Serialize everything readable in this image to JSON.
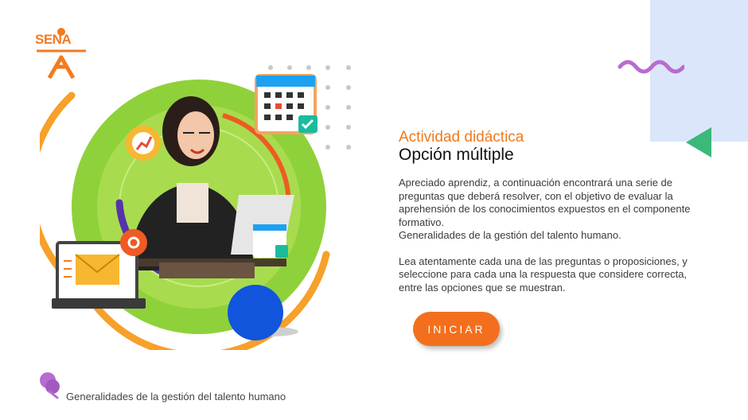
{
  "brand": {
    "logo_text": "SENA"
  },
  "activity": {
    "type_label": "Actividad didáctica",
    "title": "Opción múltiple",
    "paragraph1": "Apreciado aprendiz, a continuación encontrará una serie de preguntas que deberá resolver, con el objetivo de evaluar la aprehensión de los conocimientos expuestos en el componente formativo.",
    "paragraph2": "Generalidades de la gestión del talento humano.",
    "paragraph3": "Lea atentamente cada una de las preguntas o proposiciones, y seleccione para cada una la respuesta que considere correcta, entre las opciones que se muestran."
  },
  "actions": {
    "start_label": "INICIAR"
  },
  "footer": {
    "course_name": "Generalidades de la gestión del talento humano"
  },
  "colors": {
    "accent_orange": "#f36f1e",
    "green": "#8fd13a",
    "blue": "#1155dd",
    "purple": "#b96bd0",
    "panel_blue": "#dbe6fb",
    "triangle_green": "#3cb878"
  },
  "icons": [
    "sena-logo",
    "calendar-icon",
    "gear-chart-icon",
    "email-icon",
    "at-sign-icon",
    "pin-icon"
  ]
}
